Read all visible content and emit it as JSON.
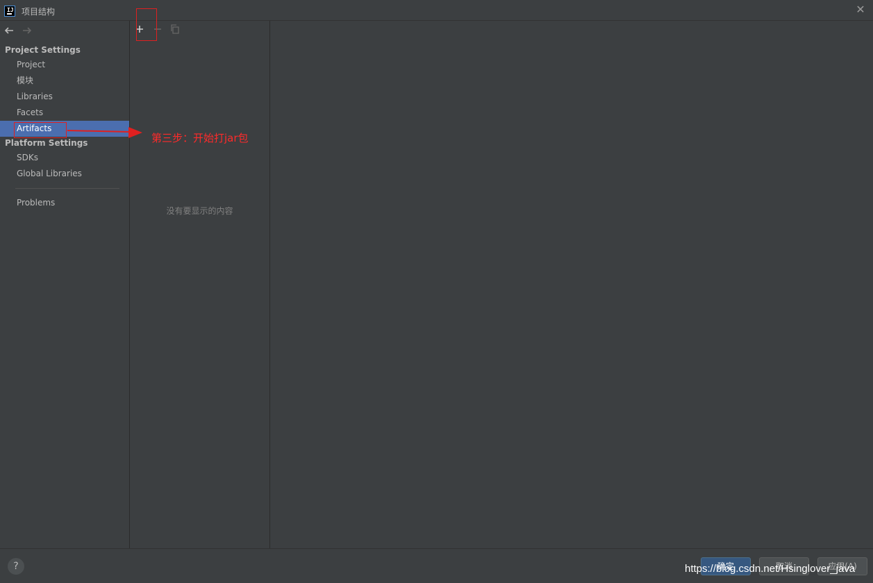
{
  "window": {
    "title": "项目结构",
    "close_icon": "close-icon"
  },
  "sidebar": {
    "nav": {
      "back_icon": "arrow-left-icon",
      "forward_icon": "arrow-right-icon"
    },
    "project_settings_label": "Project Settings",
    "project_items": [
      "Project",
      "模块",
      "Libraries",
      "Facets",
      "Artifacts"
    ],
    "selected_item": "Artifacts",
    "platform_settings_label": "Platform Settings",
    "platform_items": [
      "SDKs",
      "Global Libraries"
    ],
    "problems_label": "Problems"
  },
  "middle": {
    "toolbar": {
      "add_icon": "plus-icon",
      "remove_icon": "minus-icon",
      "copy_icon": "copy-icon"
    },
    "empty_text": "没有要显示的内容"
  },
  "footer": {
    "help_label": "?",
    "ok_label": "确定",
    "cancel_label": "取消",
    "apply_label": "应用(A)"
  },
  "annotation": {
    "text": "第三步：开始打jar包",
    "color": "#ff2a2a"
  },
  "watermark": "https://blog.csdn.net/Hsinglover_java",
  "colors": {
    "background": "#3c3f41",
    "selection": "#4b6eaf",
    "primary_button": "#365880"
  }
}
